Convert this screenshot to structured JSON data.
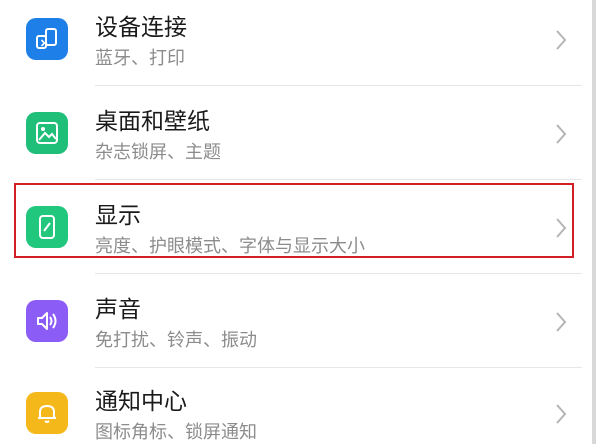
{
  "settings": {
    "items": [
      {
        "title": "设备连接",
        "subtitle": "蓝牙、打印",
        "icon": "device-connection-icon",
        "icon_color": "#1f7fe8"
      },
      {
        "title": "桌面和壁纸",
        "subtitle": "杂志锁屏、主题",
        "icon": "wallpaper-icon",
        "icon_color": "#1fbf7a"
      },
      {
        "title": "显示",
        "subtitle": "亮度、护眼模式、字体与显示大小",
        "icon": "display-icon",
        "icon_color": "#21c77c"
      },
      {
        "title": "声音",
        "subtitle": "免打扰、铃声、振动",
        "icon": "sound-icon",
        "icon_color": "#8b5cf6"
      },
      {
        "title": "通知中心",
        "subtitle": "图标角标、锁屏通知",
        "icon": "notification-bell-icon",
        "icon_color": "#f5b81a"
      }
    ],
    "highlighted_item": "显示",
    "highlight_color": "#d21f25"
  }
}
